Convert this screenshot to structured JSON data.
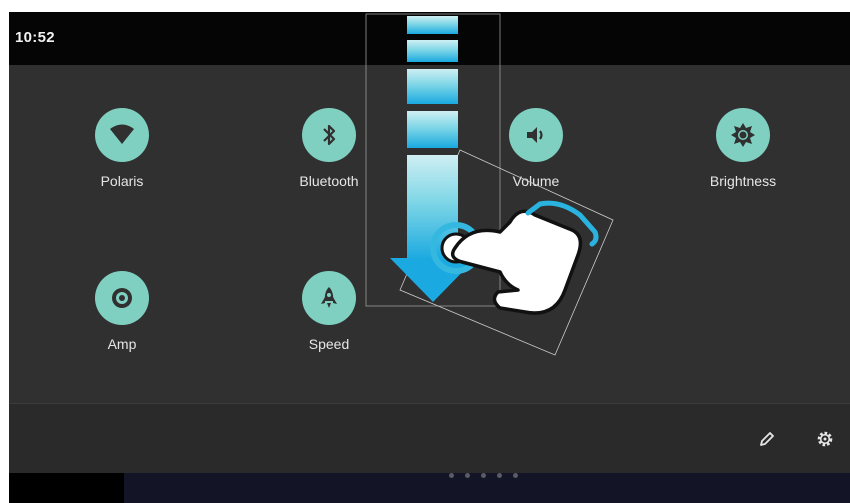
{
  "status_bar": {
    "time": "10:52"
  },
  "tiles": [
    {
      "label": "Polaris",
      "icon": "wifi-icon"
    },
    {
      "label": "Bluetooth",
      "icon": "bluetooth-icon"
    },
    {
      "label": "Volume",
      "icon": "volume-icon"
    },
    {
      "label": "Brightness",
      "icon": "brightness-icon"
    },
    {
      "label": "Amp",
      "icon": "speaker-icon"
    },
    {
      "label": "Speed",
      "icon": "rocket-icon"
    }
  ],
  "footer": {
    "edit_icon": "pencil-icon",
    "settings_icon": "gear-icon"
  },
  "page_indicator": {
    "count": 5
  },
  "overlay": {
    "gesture_icon": "swipe-down-hand-icon"
  },
  "colors": {
    "accent": "#7fd0c0",
    "panel": "#303030",
    "arrow": "#29b6e3"
  }
}
